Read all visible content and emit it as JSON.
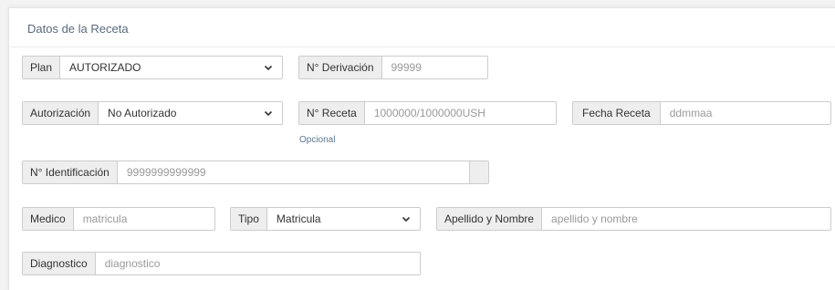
{
  "section_title": "Datos de la Receta",
  "plan": {
    "label": "Plan",
    "value": "AUTORIZADO"
  },
  "derivacion": {
    "label": "N° Derivación",
    "placeholder": "99999"
  },
  "autorizacion": {
    "label": "Autorización",
    "value": "No Autorizado"
  },
  "receta": {
    "label": "N° Receta",
    "placeholder": "1000000/1000000USH",
    "help": "Opcional"
  },
  "fecha_receta": {
    "label": "Fecha Receta",
    "placeholder": "ddmmaa"
  },
  "identificacion": {
    "label": "N° Identificación",
    "placeholder": "9999999999999"
  },
  "medico": {
    "label": "Medico",
    "placeholder": "matricula"
  },
  "tipo": {
    "label": "Tipo",
    "value": "Matricula"
  },
  "apellido_nombre": {
    "label": "Apellido y Nombre",
    "placeholder": "apellido y nombre"
  },
  "diagnostico": {
    "label": "Diagnostico",
    "placeholder": "diagnostico"
  },
  "icons": {
    "select_arrow": "chevron-down-icon"
  },
  "colors": {
    "addon_bg": "#eeeeee",
    "border": "#cccccc",
    "help_text": "#5a7891",
    "title_text": "#5a6a7a"
  }
}
